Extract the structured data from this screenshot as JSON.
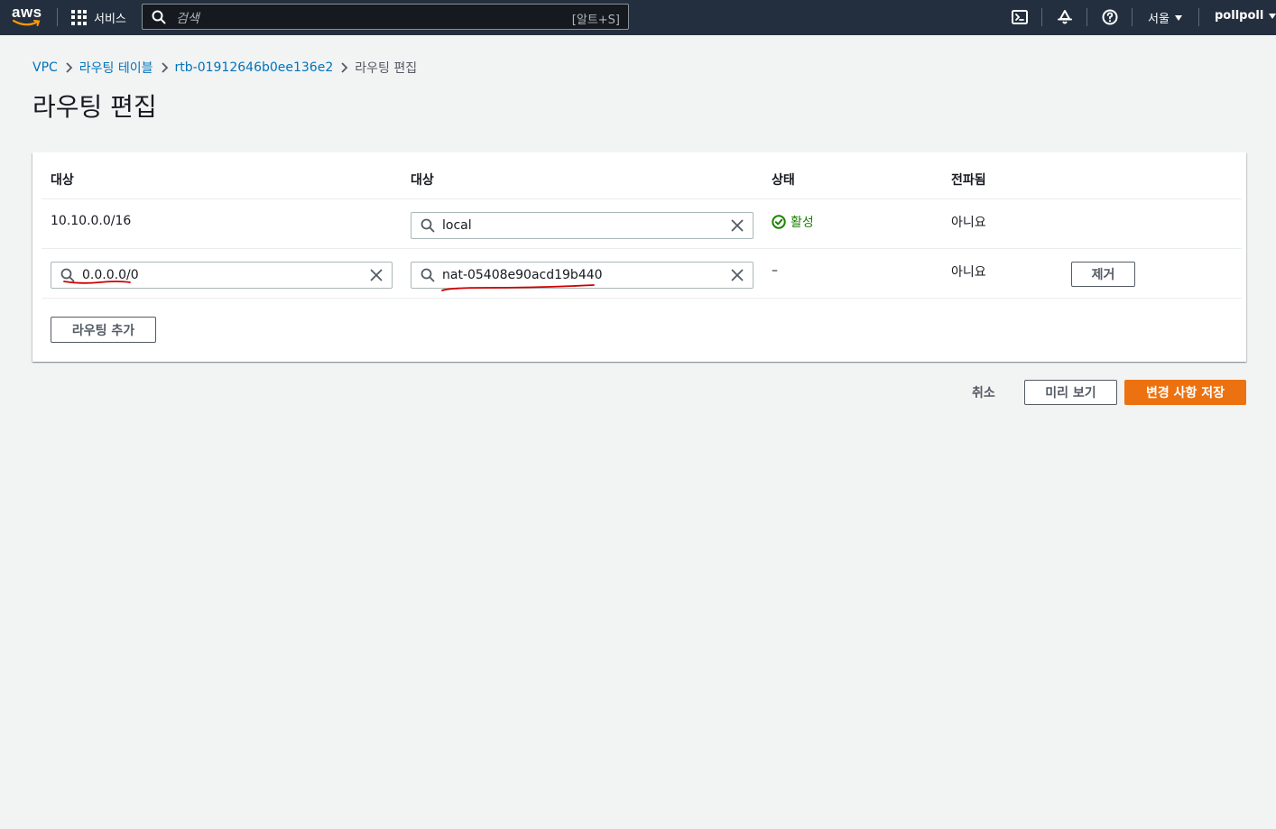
{
  "nav": {
    "logo_text": "aws",
    "services_label": "서비스",
    "search_placeholder": "검색",
    "search_shortcut": "[알트+S]",
    "region": "서울",
    "user": "pollpoll"
  },
  "breadcrumb": {
    "items": [
      "VPC",
      "라우팅 테이블",
      "rtb-01912646b0ee136e2"
    ],
    "current": "라우팅 편집"
  },
  "page": {
    "title": "라우팅 편집"
  },
  "table": {
    "headers": [
      "대상",
      "대상",
      "상태",
      "전파됨"
    ],
    "rows": [
      {
        "destination": "10.10.0.0/16",
        "target": "local",
        "status": "활성",
        "propagated": "아니요"
      },
      {
        "destination": "0.0.0.0/0",
        "target": "nat-05408e90acd19b440",
        "status": "–",
        "propagated": "아니요",
        "remove_label": "제거"
      }
    ],
    "add_route_label": "라우팅 추가"
  },
  "actions": {
    "cancel": "취소",
    "preview": "미리 보기",
    "save": "변경 사항 저장"
  },
  "colors": {
    "nav_bg": "#232f3e",
    "link": "#0073bb",
    "success": "#1d8102",
    "primary": "#ec7211",
    "annotation": "#d00000"
  }
}
